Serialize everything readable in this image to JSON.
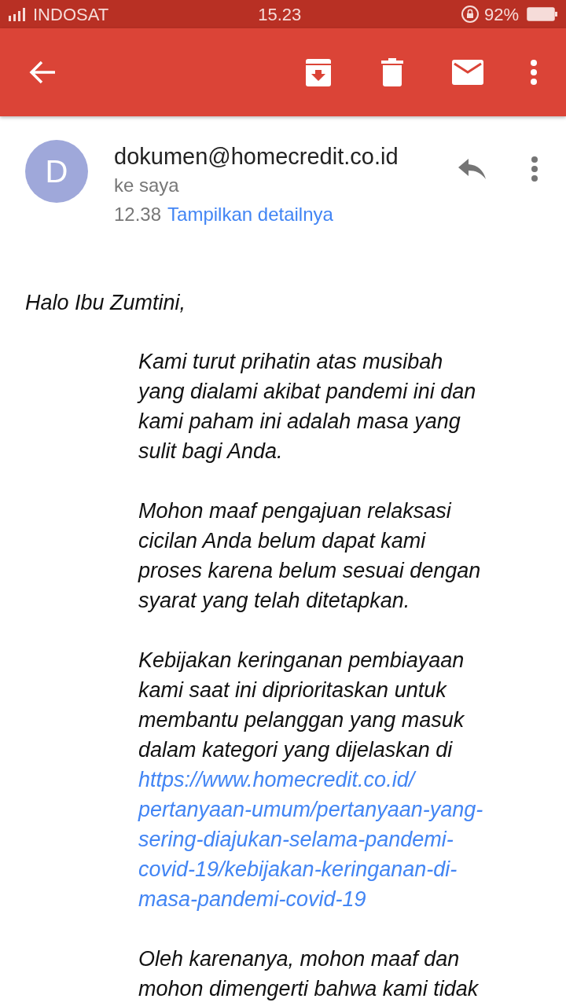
{
  "status_bar": {
    "carrier": "INDOSAT",
    "time": "15.23",
    "battery": "92%"
  },
  "sender": {
    "avatar_letter": "D",
    "address": "dokumen@homecredit.co.id",
    "recipient": "ke saya",
    "time": "12.38",
    "details_link": "Tampilkan detailnya"
  },
  "greeting": "Halo Ibu Zumtini,",
  "paragraphs": [
    {
      "lines": [
        "Kami turut prihatin atas musibah",
        "yang dialami akibat pandemi ini dan",
        "kami paham ini adalah masa yang",
        "sulit bagi Anda."
      ]
    },
    {
      "lines": [
        "Mohon maaf pengajuan relaksasi",
        "cicilan Anda belum dapat kami",
        "proses karena belum sesuai dengan",
        "syarat yang telah ditetapkan."
      ]
    },
    {
      "lines": [
        "Kebijakan keringanan pembiayaan",
        "kami saat ini diprioritaskan untuk",
        "membantu pelanggan yang masuk",
        "dalam kategori yang dijelaskan di"
      ],
      "link_lines": [
        "https://www.homecredit.co.id/",
        "pertanyaan-umum/pertanyaan-yang-",
        "sering-diajukan-selama-pandemi-",
        "covid-19/kebijakan-keringanan-di-",
        "masa-pandemi-covid-19"
      ]
    },
    {
      "lines": [
        "Oleh karenanya, mohon maaf dan",
        "mohon dimengerti bahwa kami tidak"
      ]
    }
  ]
}
